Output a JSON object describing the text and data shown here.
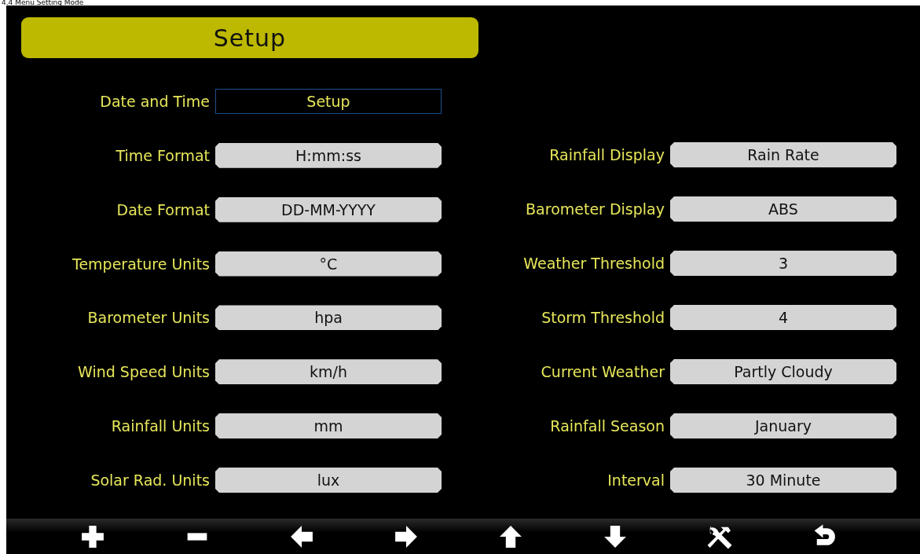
{
  "caption": "4.4 Menu Setting Mode",
  "title": "Setup",
  "left_column": [
    {
      "label": "Date and Time",
      "value": "Setup",
      "selected": true
    },
    {
      "label": "Time Format",
      "value": "H:mm:ss",
      "selected": false
    },
    {
      "label": "Date Format",
      "value": "DD-MM-YYYY",
      "selected": false
    },
    {
      "label": "Temperature Units",
      "value": "°C",
      "selected": false
    },
    {
      "label": "Barometer Units",
      "value": "hpa",
      "selected": false
    },
    {
      "label": "Wind Speed Units",
      "value": "km/h",
      "selected": false
    },
    {
      "label": "Rainfall Units",
      "value": "mm",
      "selected": false
    },
    {
      "label": "Solar Rad. Units",
      "value": "lux",
      "selected": false
    }
  ],
  "right_column": [
    {
      "label": "Rainfall Display",
      "value": "Rain Rate",
      "selected": false
    },
    {
      "label": "Barometer Display",
      "value": "ABS",
      "selected": false
    },
    {
      "label": "Weather Threshold",
      "value": "3",
      "selected": false
    },
    {
      "label": "Storm Threshold",
      "value": "4",
      "selected": false
    },
    {
      "label": "Current Weather",
      "value": "Partly Cloudy",
      "selected": false
    },
    {
      "label": "Rainfall Season",
      "value": "January",
      "selected": false
    },
    {
      "label": "Interval",
      "value": "30 Minute",
      "selected": false
    }
  ],
  "toolbar": [
    {
      "kind": "plus"
    },
    {
      "kind": "minus"
    },
    {
      "kind": "left"
    },
    {
      "kind": "right"
    },
    {
      "kind": "up"
    },
    {
      "kind": "down"
    },
    {
      "kind": "tools"
    },
    {
      "kind": "back"
    }
  ]
}
